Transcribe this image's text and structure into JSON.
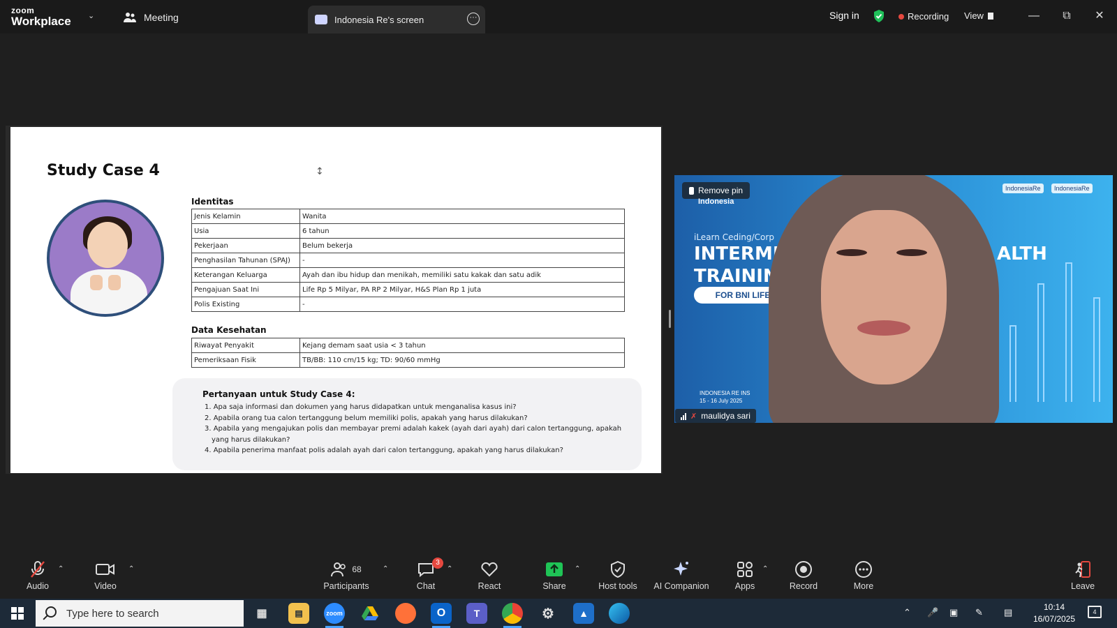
{
  "titlebar": {
    "logo_top": "zoom",
    "logo_bottom": "Workplace",
    "meeting_label": "Meeting",
    "share_tab_label": "Indonesia Re's screen",
    "sign_in": "Sign in",
    "recording": "Recording",
    "view": "View"
  },
  "slide": {
    "title": "Study Case 4",
    "identitas_heading": "Identitas",
    "identitas": [
      {
        "key": "Jenis Kelamin",
        "value": "Wanita"
      },
      {
        "key": "Usia",
        "value": "6 tahun"
      },
      {
        "key": "Pekerjaan",
        "value": "Belum bekerja"
      },
      {
        "key": "Penghasilan Tahunan (SPAJ)",
        "value": "-"
      },
      {
        "key": "Keterangan Keluarga",
        "value": "Ayah dan ibu hidup dan menikah, memiliki satu kakak dan satu adik"
      },
      {
        "key": "Pengajuan Saat Ini",
        "value": "Life Rp 5 Milyar, PA RP 2 Milyar, H&S Plan Rp 1 juta"
      },
      {
        "key": "Polis Existing",
        "value": "-"
      }
    ],
    "kesehatan_heading": "Data Kesehatan",
    "kesehatan": [
      {
        "key": "Riwayat Penyakit",
        "value": "Kejang demam saat usia < 3 tahun"
      },
      {
        "key": "Pemeriksaan Fisik",
        "value": "TB/BB: 110 cm/15 kg; TD: 90/60 mmHg"
      }
    ],
    "questions_heading": "Pertanyaan untuk Study Case 4:",
    "questions": [
      "1. Apa saja informasi dan dokumen yang harus didapatkan untuk menganalisa kasus ini?",
      "2. Apabila orang tua calon tertanggung belum memiliki polis, apakah yang harus dilakukan?",
      "3. Apabila yang mengajukan polis dan membayar premi adalah kakek (ayah dari ayah) dari calon tertanggung, apakah yang harus dilakukan?",
      "4. Apabila penerima manfaat polis adalah ayah dari calon tertanggung, apakah yang harus dilakukan?"
    ]
  },
  "video": {
    "remove_pin": "Remove pin",
    "pin_sub": "Indonesia",
    "banner_small": "iLearn Ceding/Corp",
    "banner_big1": "INTERMED",
    "banner_big2": "TRAINING",
    "banner_big3": "ALTH",
    "banner_pill": "FOR BNI LIFE",
    "logo_left": "IndonesiaRe",
    "logo_right": "IndonesiaRe",
    "event_line1": "INDONESIA RE INS",
    "event_line2": "15 - 16 July 2025",
    "participant_name": "maulidya sari"
  },
  "toolbar": {
    "audio": "Audio",
    "video": "Video",
    "participants": "Participants",
    "participants_count": "68",
    "chat": "Chat",
    "chat_badge": "3",
    "react": "React",
    "share": "Share",
    "host_tools": "Host tools",
    "ai_companion": "AI Companion",
    "apps": "Apps",
    "record": "Record",
    "more": "More",
    "leave": "Leave"
  },
  "taskbar": {
    "search_placeholder": "Type here to search",
    "zoom_app": "zoom",
    "time": "10:14",
    "date": "16/07/2025",
    "notifications": "4"
  },
  "colors": {
    "accent_green": "#20c15a",
    "record_red": "#e5483f",
    "share_green": "#1fc456"
  }
}
